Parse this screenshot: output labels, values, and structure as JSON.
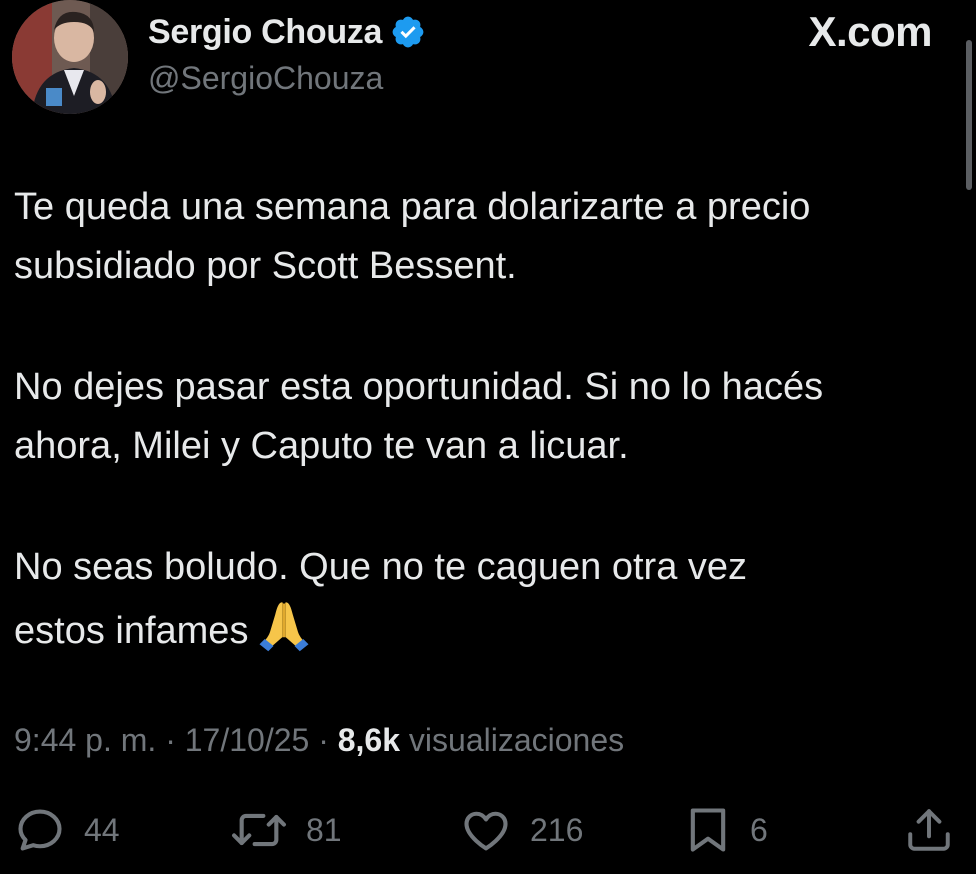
{
  "author": {
    "name": "Sergio Chouza",
    "handle": "@SergioChouza",
    "verified": true,
    "verified_color": "#1d9bf0"
  },
  "site_label": "X.com",
  "tweet": {
    "paragraphs": [
      "Te queda una semana para dolarizarte a precio\nsubsidiado por Scott Bessent.",
      "No dejes pasar esta oportunidad. Si no lo hacés\nahora, Milei y Caputo te van a licuar.",
      "No seas boludo. Que no te caguen otra vez\nestos infames"
    ],
    "emoji_icon": "folded-hands-icon"
  },
  "meta": {
    "time": "9:44 p. m.",
    "sep1": " · ",
    "date": "17/10/25",
    "sep2": " · ",
    "views_count": "8,6k",
    "views_label": " visualizaciones"
  },
  "actions": {
    "replies": "44",
    "reposts": "81",
    "likes": "216",
    "bookmarks": "6"
  },
  "colors": {
    "background": "#000000",
    "text": "#e7e9ea",
    "secondary": "#71767b",
    "verified": "#1d9bf0"
  }
}
